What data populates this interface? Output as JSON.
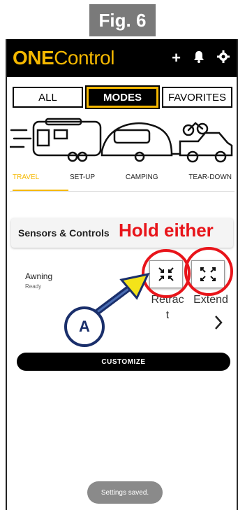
{
  "figure_label": "Fig. 6",
  "app": {
    "brand_bold": "ONE",
    "brand_light": "Control",
    "icons": [
      "plus-icon",
      "bell-icon",
      "gear-icon"
    ]
  },
  "top_tabs": [
    "ALL",
    "MODES",
    "FAVORITES"
  ],
  "active_top_tab": "MODES",
  "mode_tabs": [
    "TRAVEL",
    "SET-UP",
    "CAMPING",
    "TEAR-DOWN"
  ],
  "active_mode_tab": "TRAVEL",
  "section_title": "Sensors & Controls",
  "awning": {
    "name": "Awning",
    "status": "Ready",
    "retract_label_line1": "Retrac",
    "retract_label_line2": "t",
    "extend_label": "Extend"
  },
  "customize_label": "CUSTOMIZE",
  "toast": "Settings saved.",
  "annotations": {
    "hold_text": "Hold either",
    "callout_letter": "A"
  },
  "colors": {
    "brand": "#f5b800",
    "annotation_red": "#e8141a",
    "callout_blue": "#1a2f6b",
    "arrow_yellow": "#f3e31a"
  }
}
